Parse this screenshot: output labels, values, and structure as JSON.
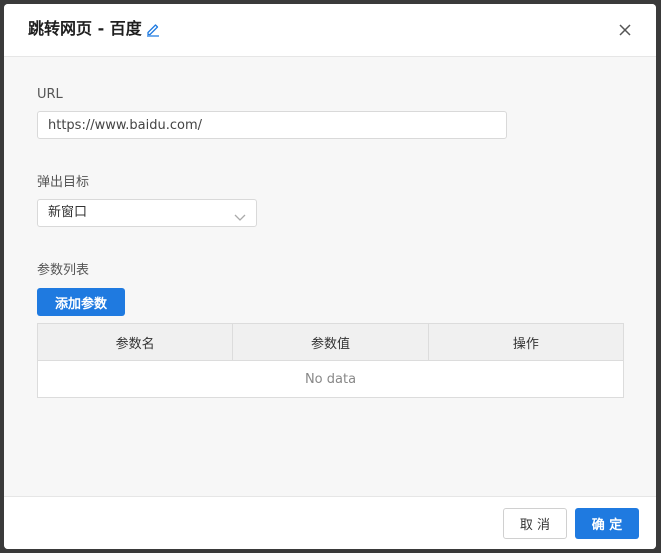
{
  "dialog": {
    "title": "跳转网页 - 百度",
    "edit_icon": "pencil-icon",
    "close_icon": "close-icon"
  },
  "url_field": {
    "label": "URL",
    "value": "https://www.baidu.com/"
  },
  "target_field": {
    "label": "弹出目标",
    "selected": "新窗口",
    "icon": "chevron-down-icon"
  },
  "params": {
    "label": "参数列表",
    "add_button": "添加参数",
    "columns": [
      "参数名",
      "参数值",
      "操作"
    ],
    "empty_text": "No data"
  },
  "footer": {
    "cancel": "取 消",
    "confirm": "确 定"
  },
  "colors": {
    "primary": "#1f7ae0",
    "border": "#d9d9d9",
    "background": "#f7f7f7"
  }
}
